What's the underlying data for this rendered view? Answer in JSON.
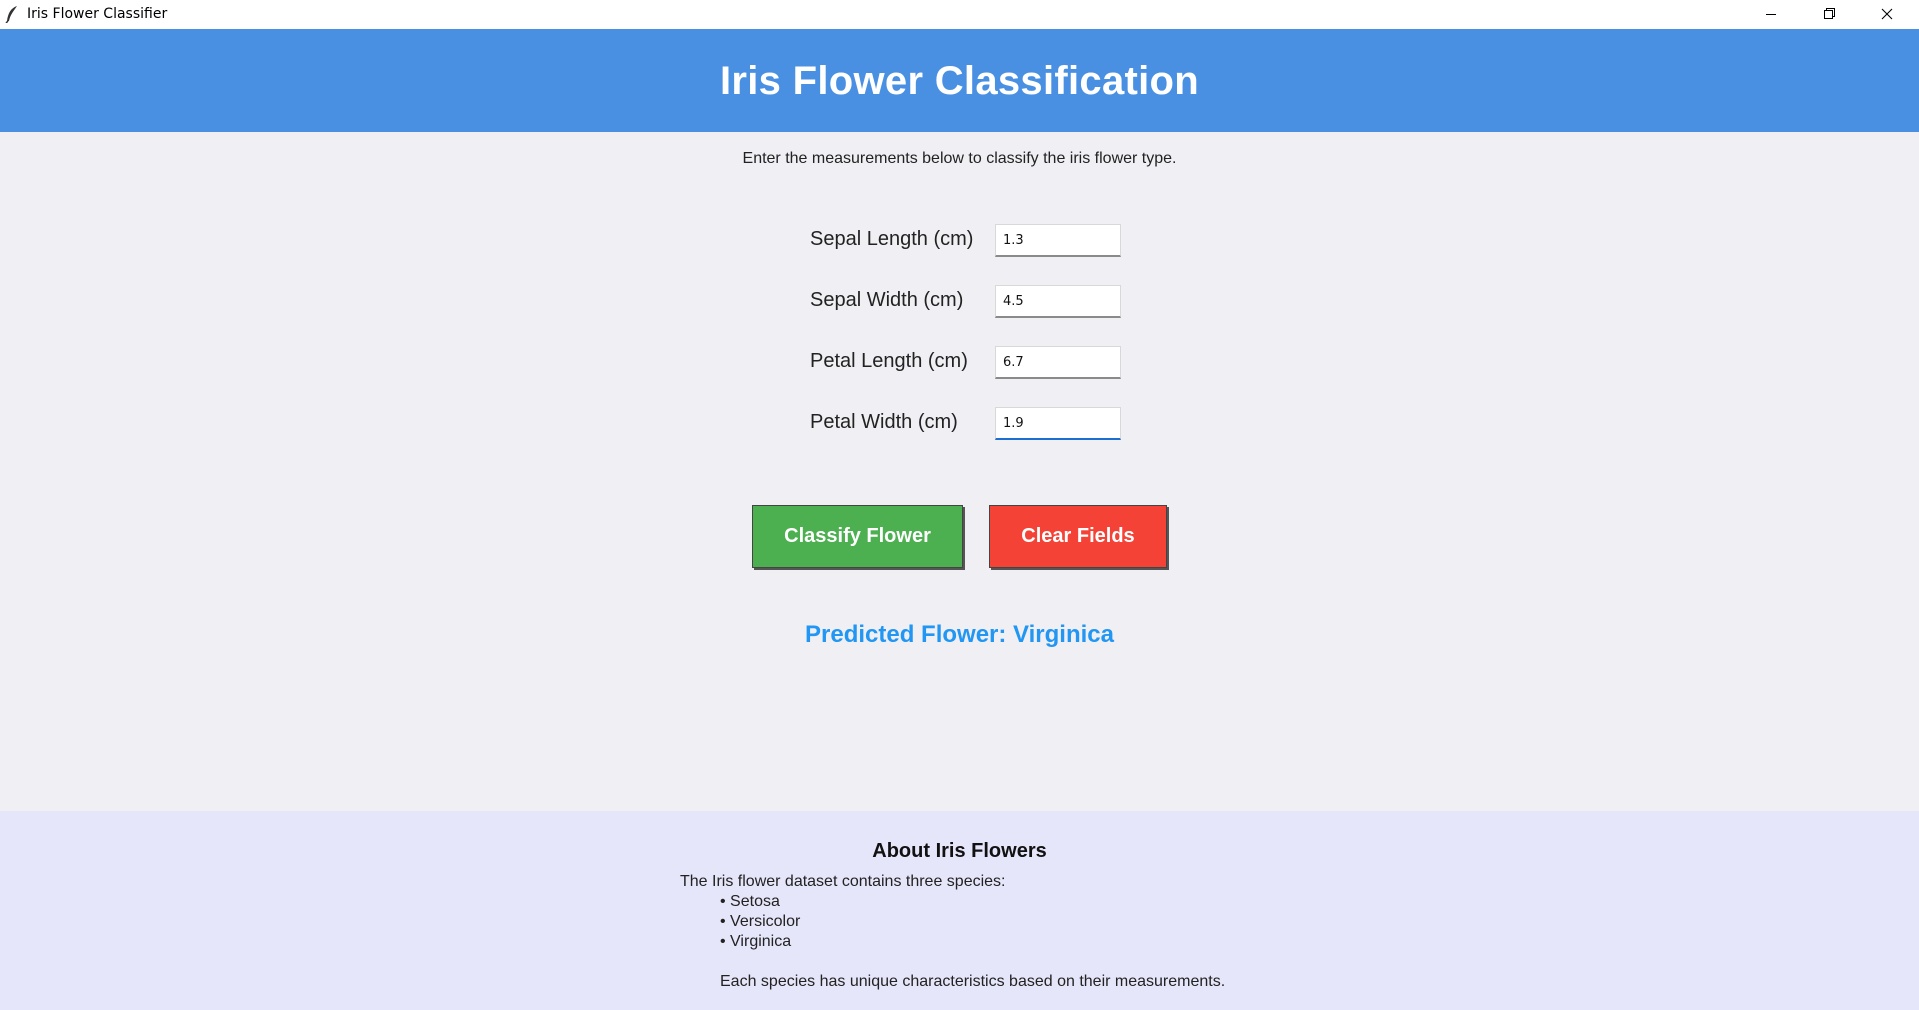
{
  "window": {
    "title": "Iris Flower Classifier"
  },
  "header": {
    "title": "Iris Flower Classification",
    "background": "#4a90e2"
  },
  "instruction": "Enter the measurements below to classify the iris flower type.",
  "form": {
    "fields": [
      {
        "label": "Sepal Length (cm)",
        "value": "1.3"
      },
      {
        "label": "Sepal Width (cm)",
        "value": "4.5"
      },
      {
        "label": "Petal Length (cm)",
        "value": "6.7"
      },
      {
        "label": "Petal Width (cm)",
        "value": "1.9"
      }
    ]
  },
  "buttons": {
    "classify_label": "Classify Flower",
    "classify_color": "#4caf50",
    "clear_label": "Clear Fields",
    "clear_color": "#f44336"
  },
  "prediction": {
    "text": "Predicted Flower: Virginica",
    "color": "#2196f3"
  },
  "about": {
    "title": "About Iris Flowers",
    "intro": "The Iris flower dataset contains three species:",
    "species": [
      "• Setosa",
      "• Versicolor",
      "• Virginica"
    ],
    "outro": "Each species has unique characteristics based on their measurements."
  },
  "icons": {
    "app": "feather-icon",
    "minimize": "minimize-icon",
    "maximize": "restore-icon",
    "close": "close-icon"
  }
}
